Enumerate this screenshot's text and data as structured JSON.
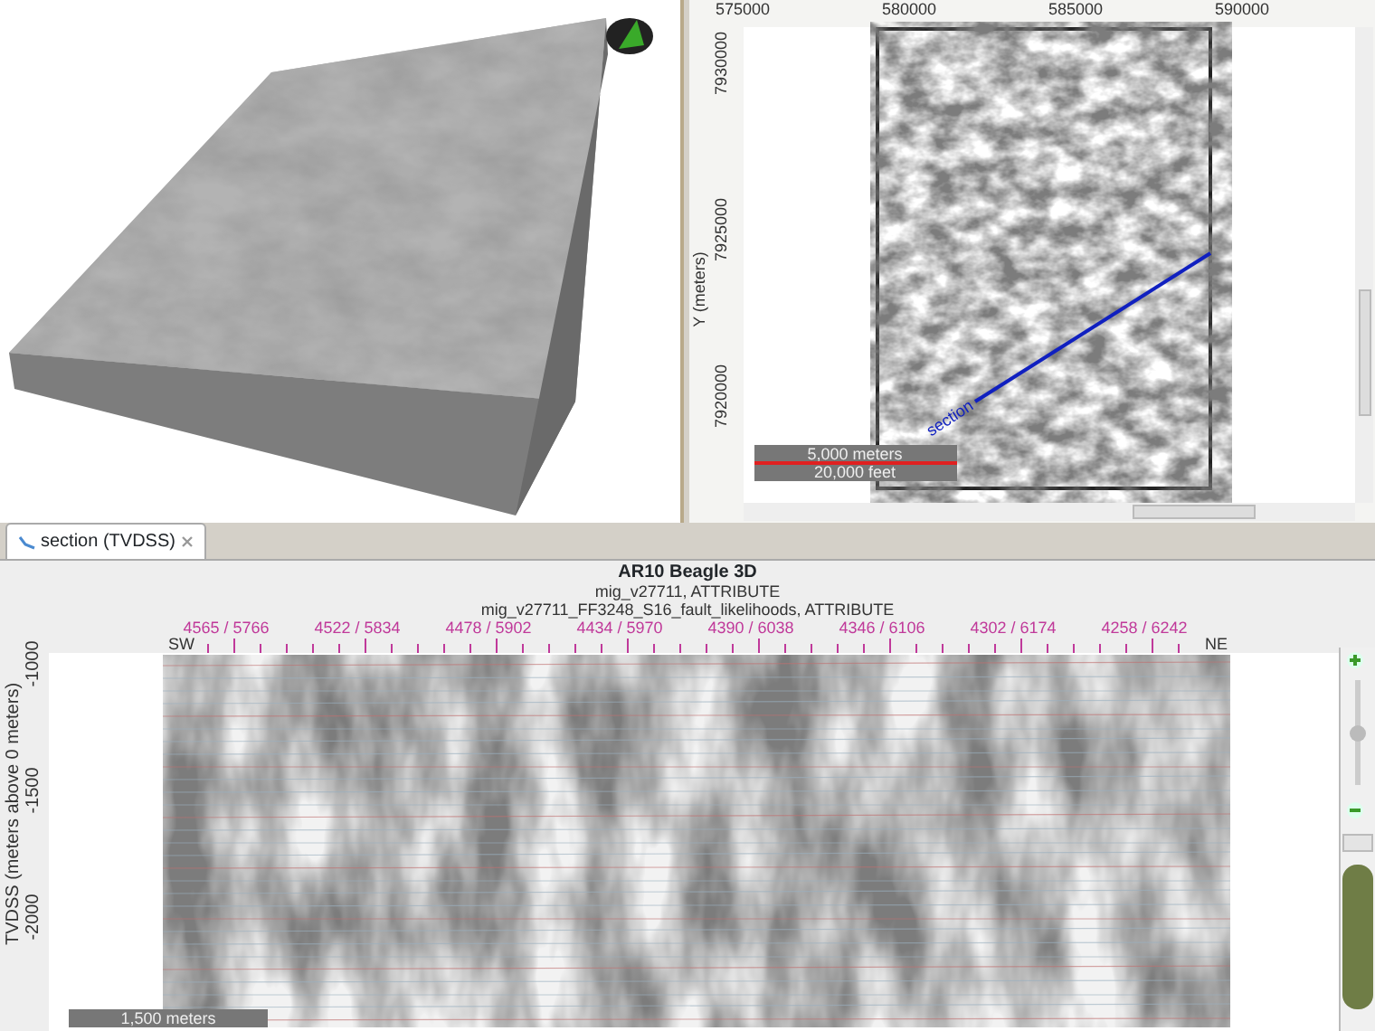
{
  "map": {
    "x_ticks": [
      "575000",
      "580000",
      "585000",
      "590000"
    ],
    "y_ticks": [
      "7930000",
      "7925000",
      "7920000"
    ],
    "y_label": "Y (meters)",
    "section_label": "section",
    "scale_bar": {
      "top_label": "5,000 meters",
      "bottom_label": "20,000 feet"
    }
  },
  "section": {
    "tab": {
      "label": "section (TVDSS)",
      "selected": true
    },
    "title": "AR10 Beagle 3D",
    "subtitles": [
      "mig_v27711, ATTRIBUTE",
      "mig_v27711_FF3248_S16_fault_likelihoods, ATTRIBUTE"
    ],
    "trace_labels": [
      "4565 / 5766",
      "4522 / 5834",
      "4478 / 5902",
      "4434 / 5970",
      "4390 / 6038",
      "4346 / 6106",
      "4302 / 6174",
      "4258 / 6242"
    ],
    "left_end": "SW",
    "right_end": "NE",
    "y_label": "TVDSS (meters above 0 meters)",
    "y_ticks": [
      "-1000",
      "-1500",
      "-2000"
    ],
    "scale_bar_label": "1,500 meters",
    "zoom_slider": {
      "level": 0.5
    }
  }
}
